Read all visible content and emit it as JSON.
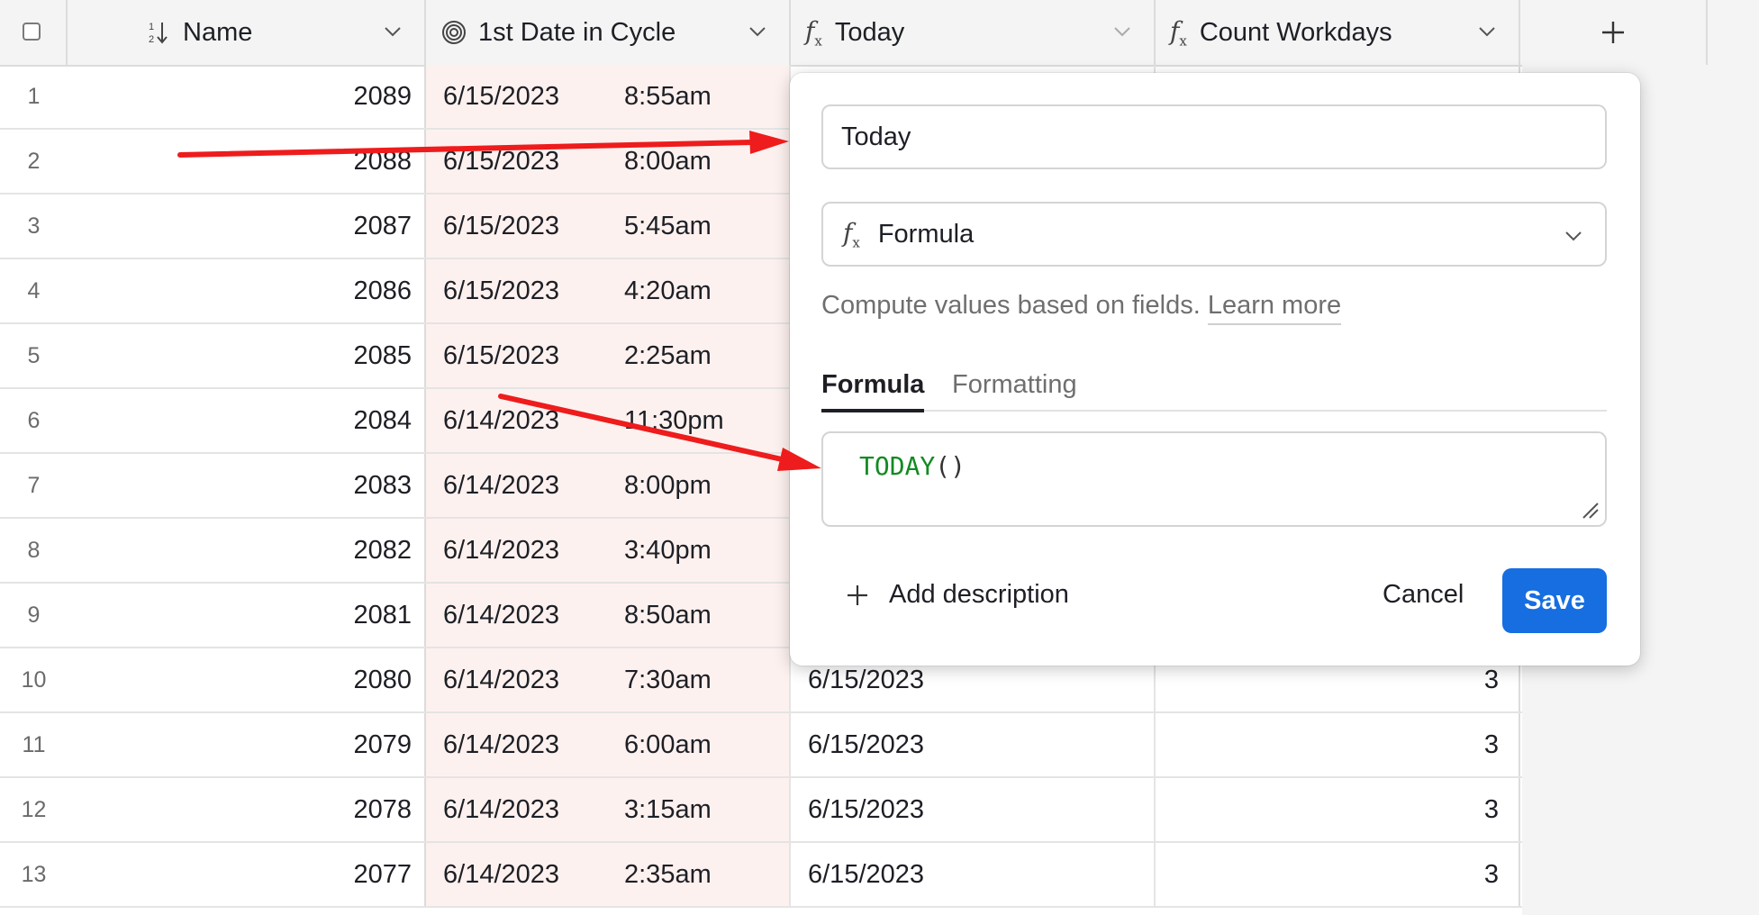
{
  "header": {
    "name_label": "Name",
    "date_label": "1st Date in Cycle",
    "today_label": "Today",
    "count_label": "Count Workdays",
    "add_field_icon": "plus-icon",
    "sort_icon": "sort-icon",
    "cycle_icon": "spiral-icon",
    "formula_icon": "fx-icon"
  },
  "rows": [
    {
      "num": "1",
      "name": "2089",
      "date": "6/15/2023",
      "time": "8:55am",
      "today": "",
      "count": ""
    },
    {
      "num": "2",
      "name": "2088",
      "date": "6/15/2023",
      "time": "8:00am",
      "today": "",
      "count": ""
    },
    {
      "num": "3",
      "name": "2087",
      "date": "6/15/2023",
      "time": "5:45am",
      "today": "",
      "count": ""
    },
    {
      "num": "4",
      "name": "2086",
      "date": "6/15/2023",
      "time": "4:20am",
      "today": "",
      "count": ""
    },
    {
      "num": "5",
      "name": "2085",
      "date": "6/15/2023",
      "time": "2:25am",
      "today": "",
      "count": ""
    },
    {
      "num": "6",
      "name": "2084",
      "date": "6/14/2023",
      "time": "11:30pm",
      "today": "",
      "count": ""
    },
    {
      "num": "7",
      "name": "2083",
      "date": "6/14/2023",
      "time": "8:00pm",
      "today": "",
      "count": ""
    },
    {
      "num": "8",
      "name": "2082",
      "date": "6/14/2023",
      "time": "3:40pm",
      "today": "",
      "count": ""
    },
    {
      "num": "9",
      "name": "2081",
      "date": "6/14/2023",
      "time": "8:50am",
      "today": "",
      "count": ""
    },
    {
      "num": "10",
      "name": "2080",
      "date": "6/14/2023",
      "time": "7:30am",
      "today": "6/15/2023",
      "count": "3"
    },
    {
      "num": "11",
      "name": "2079",
      "date": "6/14/2023",
      "time": "6:00am",
      "today": "6/15/2023",
      "count": "3"
    },
    {
      "num": "12",
      "name": "2078",
      "date": "6/14/2023",
      "time": "3:15am",
      "today": "6/15/2023",
      "count": "3"
    },
    {
      "num": "13",
      "name": "2077",
      "date": "6/14/2023",
      "time": "2:35am",
      "today": "6/15/2023",
      "count": "3"
    }
  ],
  "popover": {
    "field_name": "Today",
    "field_type": "Formula",
    "help_text": "Compute values based on fields.",
    "help_link": "Learn more",
    "tab_formula": "Formula",
    "tab_formatting": "Formatting",
    "formula_fn": "TODAY",
    "formula_parens": "()",
    "add_description": "Add description",
    "cancel": "Cancel",
    "save": "Save"
  },
  "colors": {
    "accent": "#166ee1",
    "annotation_arrow": "#ee1c1c",
    "date_column_tint": "#fdf1ef",
    "formula_green": "#138a22"
  }
}
